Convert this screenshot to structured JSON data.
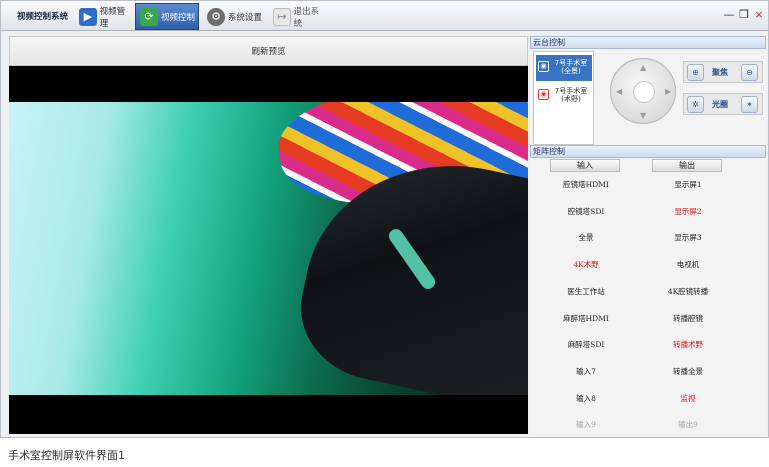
{
  "window": {
    "app_title": "视频控制系统",
    "tabs": [
      {
        "label": "视频管理",
        "icon": "clapperboard-icon",
        "active": false
      },
      {
        "label": "视频控制",
        "icon": "refresh-icon",
        "active": true
      },
      {
        "label": "系统设置",
        "icon": "gear-icon",
        "active": false
      },
      {
        "label": "退出系统",
        "icon": "exit-icon",
        "active": false
      }
    ],
    "controls": {
      "minimize": "—",
      "restore": "❐",
      "close": "×"
    }
  },
  "preview": {
    "header": "刷新预览"
  },
  "ptz": {
    "title": "云台控制",
    "cameras": [
      {
        "line1": "7号手术室",
        "line2": "(全景)",
        "selected": true
      },
      {
        "line1": "7号手术室",
        "line2": "(术野)",
        "selected": false
      }
    ],
    "focus_label": "聚焦",
    "iris_label": "光圈"
  },
  "matrix": {
    "title": "矩阵控制",
    "input_header": "输入",
    "output_header": "输出",
    "rows": [
      {
        "input": "腔镜塔HDMI",
        "output": "显示屏1",
        "input_color": "normal",
        "output_color": "normal"
      },
      {
        "input": "腔镜塔SDI",
        "output": "显示屏2",
        "input_color": "normal",
        "output_color": "red"
      },
      {
        "input": "全景",
        "output": "显示屏3",
        "input_color": "normal",
        "output_color": "normal"
      },
      {
        "input": "4K术野",
        "output": "电视机",
        "input_color": "red",
        "output_color": "normal"
      },
      {
        "input": "医生工作站",
        "output": "4K腔镜转播",
        "input_color": "normal",
        "output_color": "normal"
      },
      {
        "input": "麻醉塔HDMI",
        "output": "转播腔镜",
        "input_color": "normal",
        "output_color": "normal"
      },
      {
        "input": "麻醉塔SDI",
        "output": "转播术野",
        "input_color": "normal",
        "output_color": "red"
      },
      {
        "input": "输入7",
        "output": "转播全景",
        "input_color": "normal",
        "output_color": "normal"
      },
      {
        "input": "输入8",
        "output": "监视",
        "input_color": "normal",
        "output_color": "red"
      },
      {
        "input": "输入9",
        "output": "输出9",
        "input_color": "gray",
        "output_color": "gray"
      }
    ]
  },
  "caption": "手术室控制屏软件界面1",
  "colors": {
    "accent": "#2f5fa8",
    "highlight_red": "#e0141b",
    "panel_title": "#22336b"
  }
}
